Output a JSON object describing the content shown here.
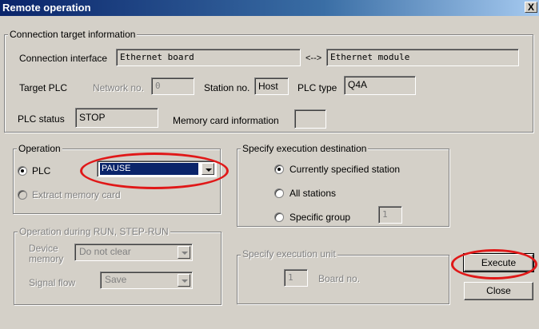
{
  "window": {
    "title": "Remote operation",
    "close_glyph": "X"
  },
  "connection": {
    "group_label": "Connection target information",
    "interface_label": "Connection interface",
    "interface_value": "Ethernet board",
    "arrow": "<-->",
    "module_value": "Ethernet module",
    "target_plc_label": "Target PLC",
    "network_label": "Network no.",
    "network_value": "0",
    "station_label": "Station no.",
    "station_value": "Host",
    "plc_type_label": "PLC type",
    "plc_type_value": "Q4A",
    "plc_status_label": "PLC status",
    "plc_status_value": "STOP",
    "memory_card_label": "Memory card information",
    "memory_card_value": ""
  },
  "operation": {
    "group_label": "Operation",
    "plc_label": "PLC",
    "plc_selected": true,
    "plc_select_value": "PAUSE",
    "extract_label": "Extract memory card",
    "extract_selected": false
  },
  "run_operation": {
    "group_label": "Operation during RUN, STEP-RUN",
    "device_memory_label": "Device memory",
    "device_memory_value": "Do not clear",
    "signal_flow_label": "Signal flow",
    "signal_flow_value": "Save"
  },
  "destination": {
    "group_label": "Specify execution destination",
    "options": [
      {
        "label": "Currently specified station",
        "selected": true
      },
      {
        "label": "All stations",
        "selected": false
      },
      {
        "label": "Specific group",
        "selected": false
      }
    ],
    "group_value": "1"
  },
  "execution_unit": {
    "group_label": "Specify execution unit",
    "board_value": "1",
    "board_label": "Board no."
  },
  "buttons": {
    "execute": "Execute",
    "close": "Close"
  },
  "colors": {
    "highlight_ring": "#e01818",
    "title_bar": "#0a246a",
    "face": "#d4d0c8"
  }
}
